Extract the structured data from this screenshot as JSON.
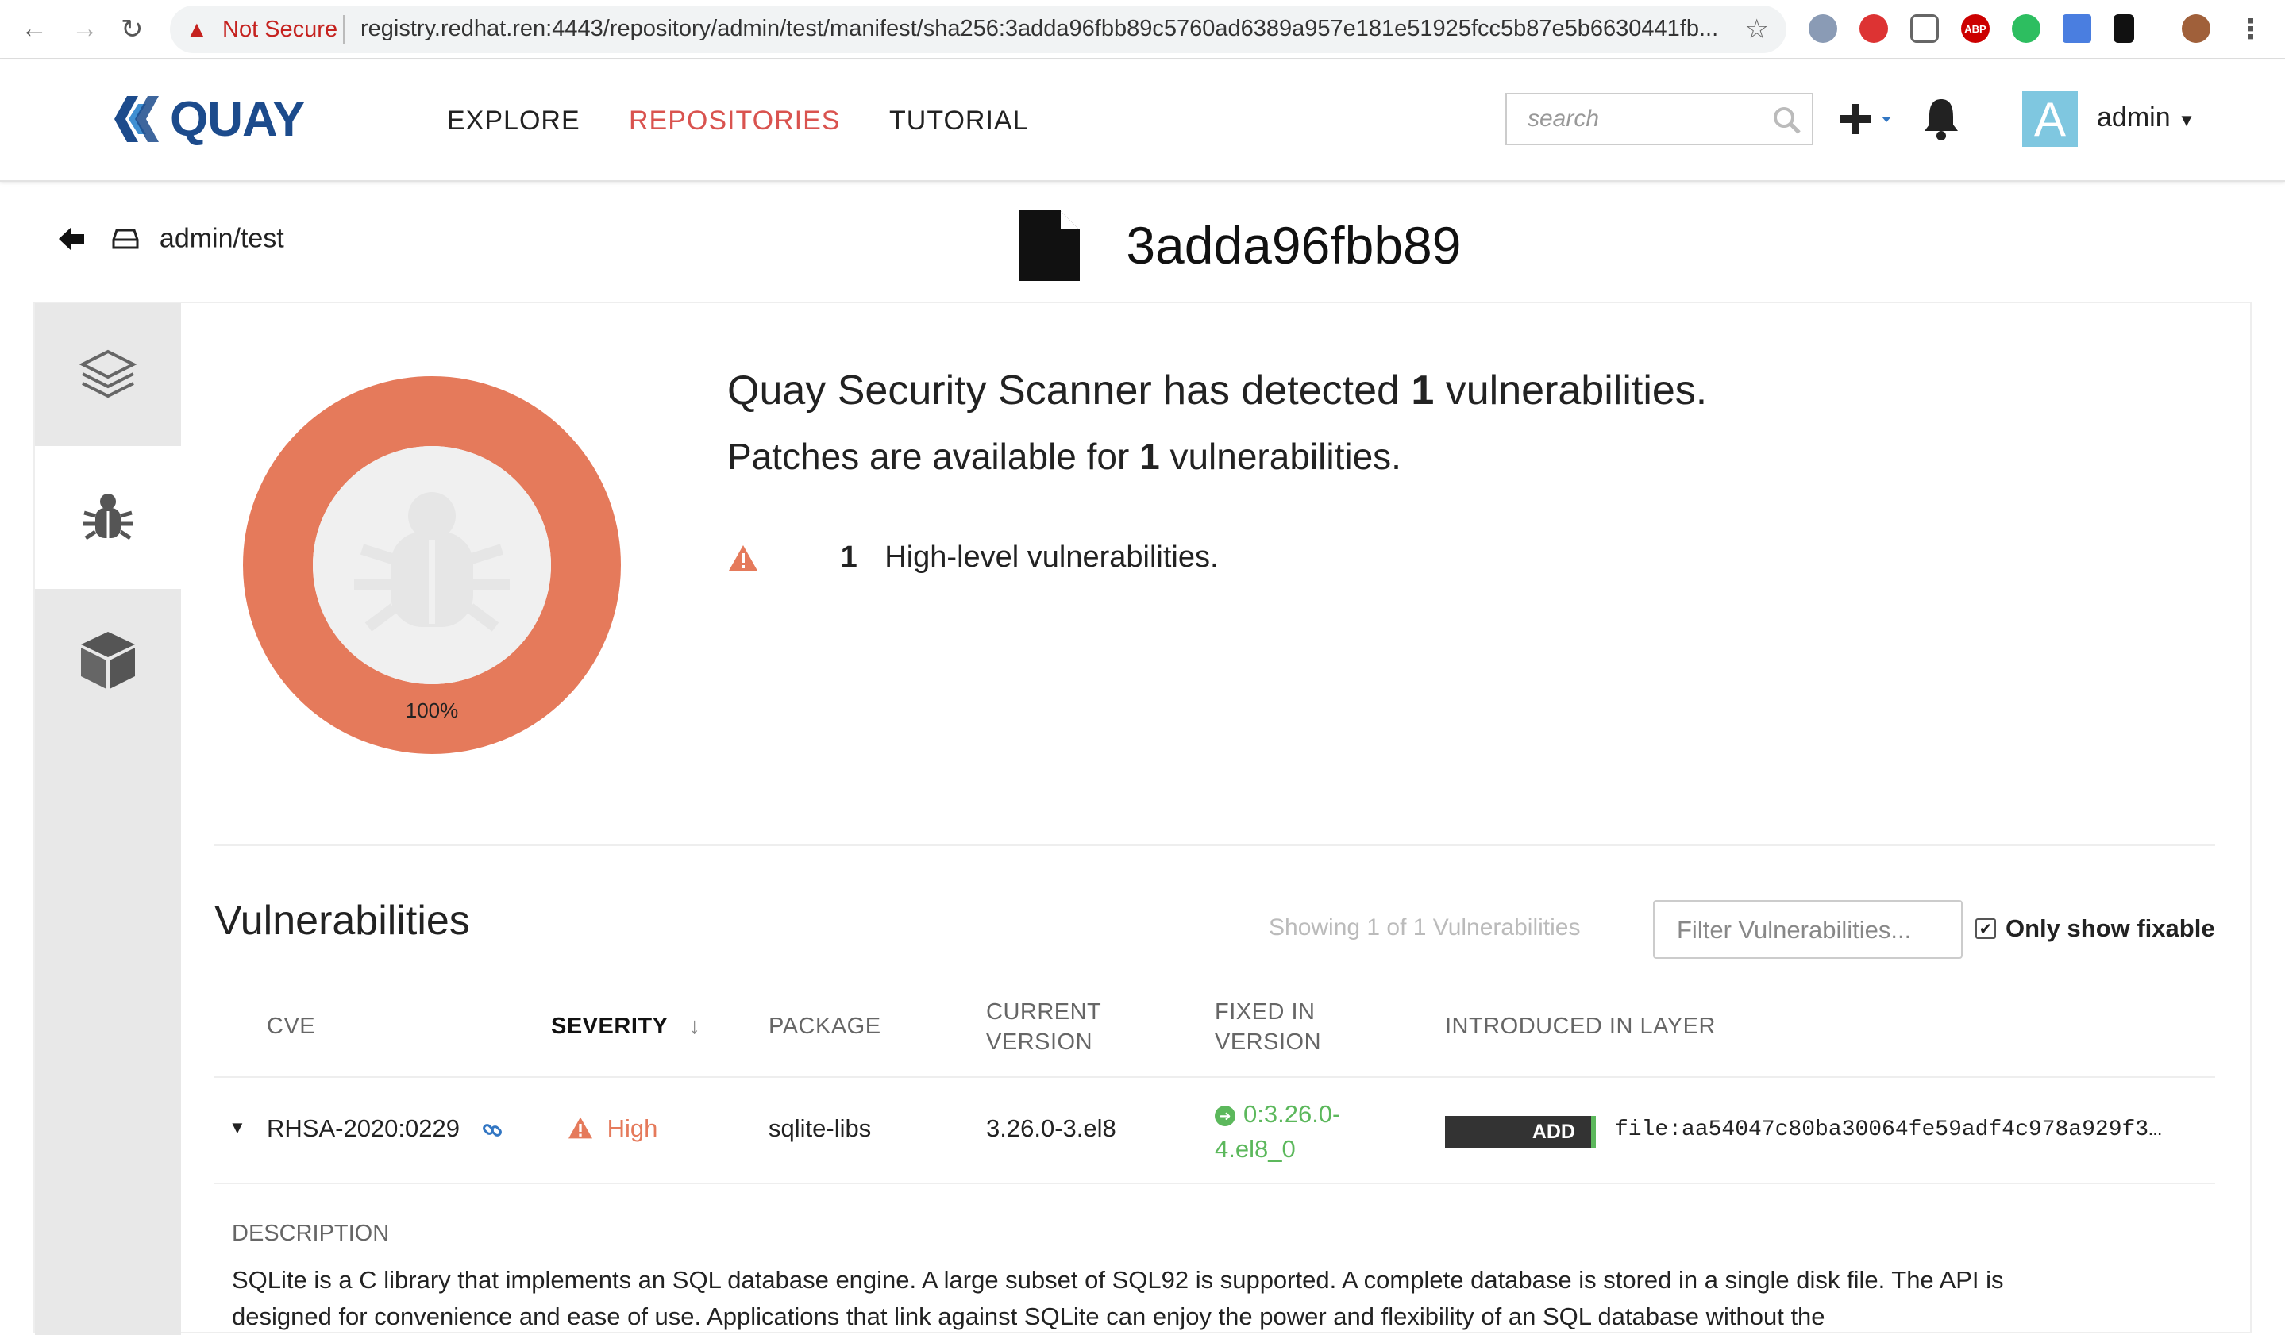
{
  "browser": {
    "security_label": "Not Secure",
    "url": "registry.redhat.ren:4443/repository/admin/test/manifest/sha256:3adda96fbb89c5760ad6389a957e181e51925fcc5b87e5b6630441fb..."
  },
  "header": {
    "brand": "QUAY",
    "nav": {
      "explore": "EXPLORE",
      "repositories": "REPOSITORIES",
      "tutorial": "TUTORIAL"
    },
    "search_placeholder": "search",
    "avatar_letter": "A",
    "username": "admin"
  },
  "page": {
    "breadcrumb": "admin/test",
    "manifest_title": "3adda96fbb89"
  },
  "summary": {
    "line1_pre": "Quay Security Scanner has detected ",
    "line1_count": "1",
    "line1_post": " vulnerabilities.",
    "line2_pre": "Patches are available for ",
    "line2_count": "1",
    "line2_post": " vulnerabilities.",
    "level_count": "1",
    "level_text": "High-level vulnerabilities.",
    "donut_label": "100%",
    "donut_fraction": 1.0,
    "colors": {
      "high": "#e57a5b"
    }
  },
  "vulnerabilities": {
    "title": "Vulnerabilities",
    "showing": "Showing 1 of 1 Vulnerabilities",
    "filter_placeholder": "Filter Vulnerabilities...",
    "only_fixable_label": "Only show fixable",
    "columns": {
      "cve": "CVE",
      "severity": "SEVERITY",
      "package": "PACKAGE",
      "current_version_1": "CURRENT",
      "current_version_2": "VERSION",
      "fixed_in_1": "FIXED IN",
      "fixed_in_2": "VERSION",
      "layer": "INTRODUCED IN LAYER"
    },
    "rows": [
      {
        "cve": "RHSA-2020:0229",
        "severity": "High",
        "package": "sqlite-libs",
        "current_version": "3.26.0-3.el8",
        "fixed_in_1": "0:3.26.0-",
        "fixed_in_2": "4.el8_0",
        "layer_badge": "ADD",
        "layer": "file:aa54047c80ba30064fe59adf4c978a929f3…"
      }
    ],
    "description_label": "DESCRIPTION",
    "description": "SQLite is a C library that implements an SQL database engine. A large subset of SQL92 is supported. A complete database is stored in a single disk file. The API is designed for convenience and ease of use. Applications that link against SQLite can enjoy the power and flexibility of an SQL database without the"
  }
}
